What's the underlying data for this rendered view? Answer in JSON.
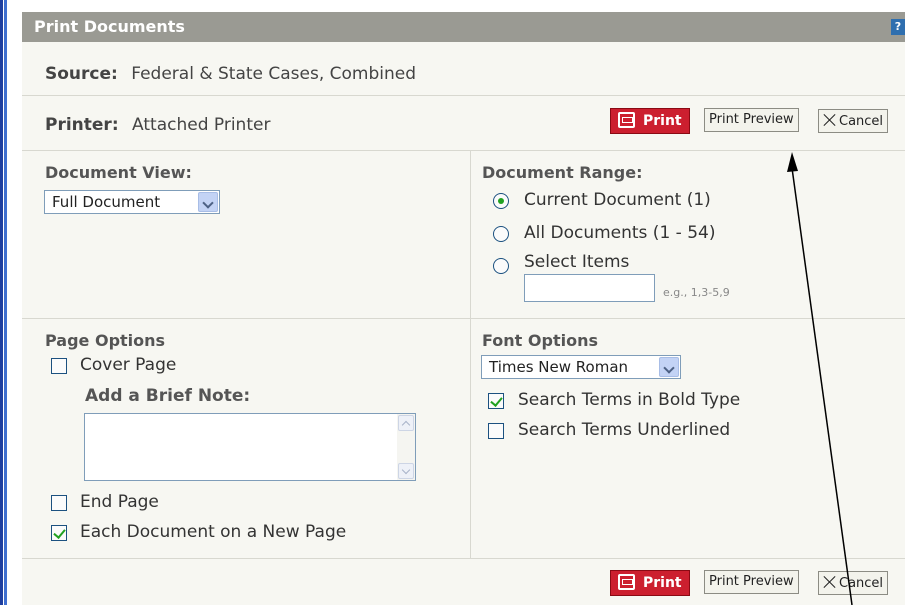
{
  "dialog": {
    "title": "Print Documents",
    "help_icon": "?"
  },
  "source": {
    "label": "Source:",
    "value": "Federal & State Cases, Combined"
  },
  "printer": {
    "label": "Printer:",
    "value": "Attached Printer"
  },
  "buttons": {
    "print_label": "Print",
    "print_preview_label": "Print Preview",
    "cancel_label": "Cancel"
  },
  "document_view": {
    "heading": "Document View:",
    "selected": "Full Document"
  },
  "document_range": {
    "heading": "Document Range:",
    "options": [
      {
        "label": "Current Document (1)",
        "selected": true
      },
      {
        "label": "All Documents (1 - 54)",
        "selected": false
      },
      {
        "label": "Select Items",
        "selected": false
      }
    ],
    "select_items_value": "",
    "hint": "e.g., 1,3-5,9"
  },
  "page_options": {
    "heading": "Page Options",
    "cover_page": {
      "label": "Cover Page",
      "checked": false
    },
    "brief_note_label": "Add a Brief Note:",
    "brief_note_value": "",
    "end_page": {
      "label": "End Page",
      "checked": false
    },
    "each_new_page": {
      "label": "Each Document on a New Page",
      "checked": true
    }
  },
  "font_options": {
    "heading": "Font Options",
    "selected_font": "Times New Roman",
    "bold_terms": {
      "label": "Search Terms in Bold Type",
      "checked": true
    },
    "underline_terms": {
      "label": "Search Terms Underlined",
      "checked": false
    }
  },
  "colors": {
    "title_bar": "#9a9a93",
    "print_button": "#cc1f2f",
    "accent_check": "#21a121",
    "left_stripe": "#1f3f9f"
  },
  "icons": [
    "help-icon",
    "printer-icon",
    "close-icon",
    "chevron-down-icon",
    "radio-icon",
    "checkbox-icon",
    "scroll-up-icon",
    "scroll-down-icon",
    "annotation-arrow"
  ]
}
